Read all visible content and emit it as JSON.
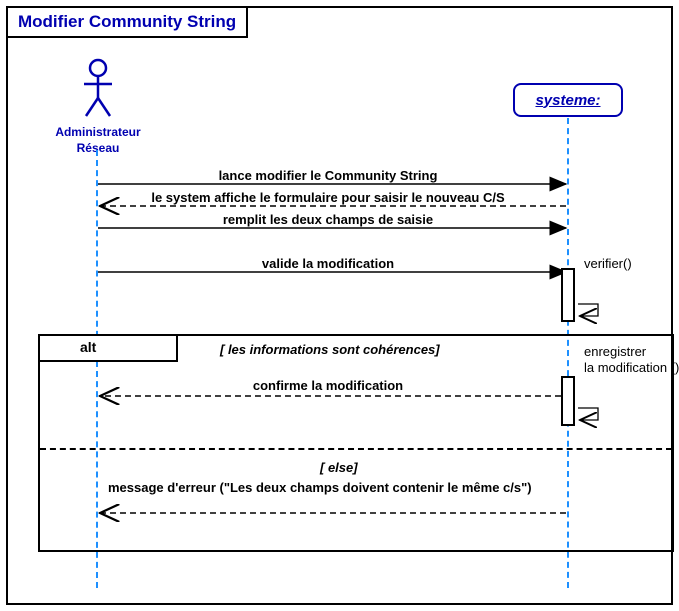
{
  "title": "Modifier Community String",
  "actor": {
    "name_line1": "Administrateur",
    "name_line2": "Réseau"
  },
  "system": {
    "label": "systeme:"
  },
  "messages": {
    "m1": "lance  modifier le Community String",
    "m2": "le system affiche le formulaire pour saisir le nouveau C/S",
    "m3": "remplit les  deux champs de saisie",
    "m4": "valide la modification",
    "verifier": "verifier()",
    "enregistrer_l1": "enregistrer",
    "enregistrer_l2": "la modification ()",
    "confirm": "confirme la modification",
    "error": "message d'erreur (\"Les deux champs  doivent contenir le même c/s\")"
  },
  "alt": {
    "label": "alt",
    "guard1": "[ les informations sont cohérences]",
    "guard2": "[ else]"
  },
  "chart_data": {
    "type": "sequence-diagram",
    "title": "Modifier Community String",
    "participants": [
      {
        "id": "admin",
        "name": "Administrateur Réseau",
        "kind": "actor"
      },
      {
        "id": "system",
        "name": "systeme",
        "kind": "object"
      }
    ],
    "messages": [
      {
        "from": "admin",
        "to": "system",
        "label": "lance modifier le Community String",
        "style": "sync"
      },
      {
        "from": "system",
        "to": "admin",
        "label": "le system affiche le formulaire pour saisir le nouveau C/S",
        "style": "return"
      },
      {
        "from": "admin",
        "to": "system",
        "label": "remplit les deux champs de saisie",
        "style": "sync"
      },
      {
        "from": "admin",
        "to": "system",
        "label": "valide la modification",
        "style": "sync"
      },
      {
        "from": "system",
        "to": "system",
        "label": "verifier()",
        "style": "self"
      }
    ],
    "fragments": [
      {
        "type": "alt",
        "operands": [
          {
            "guard": "les informations sont cohérences",
            "messages": [
              {
                "from": "system",
                "to": "system",
                "label": "enregistrer la modification ()",
                "style": "self"
              },
              {
                "from": "system",
                "to": "admin",
                "label": "confirme la modification",
                "style": "return"
              }
            ]
          },
          {
            "guard": "else",
            "messages": [
              {
                "from": "system",
                "to": "admin",
                "label": "message d'erreur (\"Les deux champs doivent contenir le même c/s\")",
                "style": "return"
              }
            ]
          }
        ]
      }
    ]
  }
}
